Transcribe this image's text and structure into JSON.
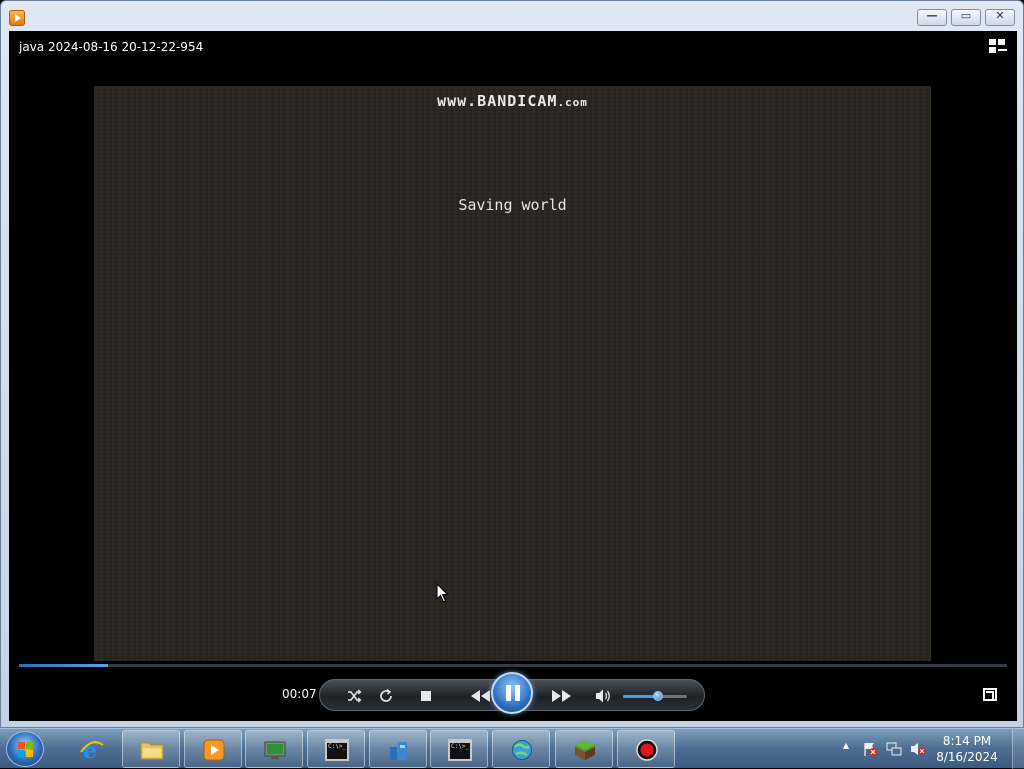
{
  "window": {
    "minimize_glyph": "—",
    "maximize_glyph": "▭",
    "close_glyph": "✕"
  },
  "player": {
    "file_title": "java 2024-08-16 20-12-22-954",
    "video": {
      "watermark_main": "www.BANDICAM",
      "watermark_suffix": ".com",
      "overlay_text": "Saving world",
      "background_color": "#2a241f"
    },
    "seek_progress": 0.09,
    "current_time": "00:07",
    "volume_level": 0.55,
    "controls": {
      "shuffle_icon": "shuffle-icon",
      "repeat_icon": "repeat-icon",
      "stop_icon": "stop-icon",
      "prev_icon": "rewind-icon",
      "play_state": "pause-icon",
      "next_icon": "fast-forward-icon",
      "volume_icon": "speaker-icon",
      "fullscreen_icon": "fullscreen-icon"
    }
  },
  "taskbar": {
    "items": [
      {
        "name": "internet-explorer",
        "icon": "ie-icon",
        "pinned": true
      },
      {
        "name": "file-explorer",
        "icon": "folder-icon",
        "pinned": false
      },
      {
        "name": "media-player",
        "icon": "media-player-icon",
        "pinned": false
      },
      {
        "name": "network-tool",
        "icon": "network-icon",
        "pinned": false
      },
      {
        "name": "command-prompt-1",
        "icon": "cmd-icon",
        "pinned": false
      },
      {
        "name": "app-blue",
        "icon": "app-icon",
        "pinned": false
      },
      {
        "name": "command-prompt-2",
        "icon": "cmd-icon",
        "pinned": false
      },
      {
        "name": "browser-globe",
        "icon": "globe-icon",
        "pinned": false
      },
      {
        "name": "minecraft",
        "icon": "grass-block-icon",
        "pinned": false
      },
      {
        "name": "bandicam",
        "icon": "record-icon",
        "pinned": false
      }
    ],
    "cmd_text": "C:\\>_",
    "clock_time": "8:14 PM",
    "clock_date": "8/16/2024",
    "tray_arrow": "▲"
  }
}
